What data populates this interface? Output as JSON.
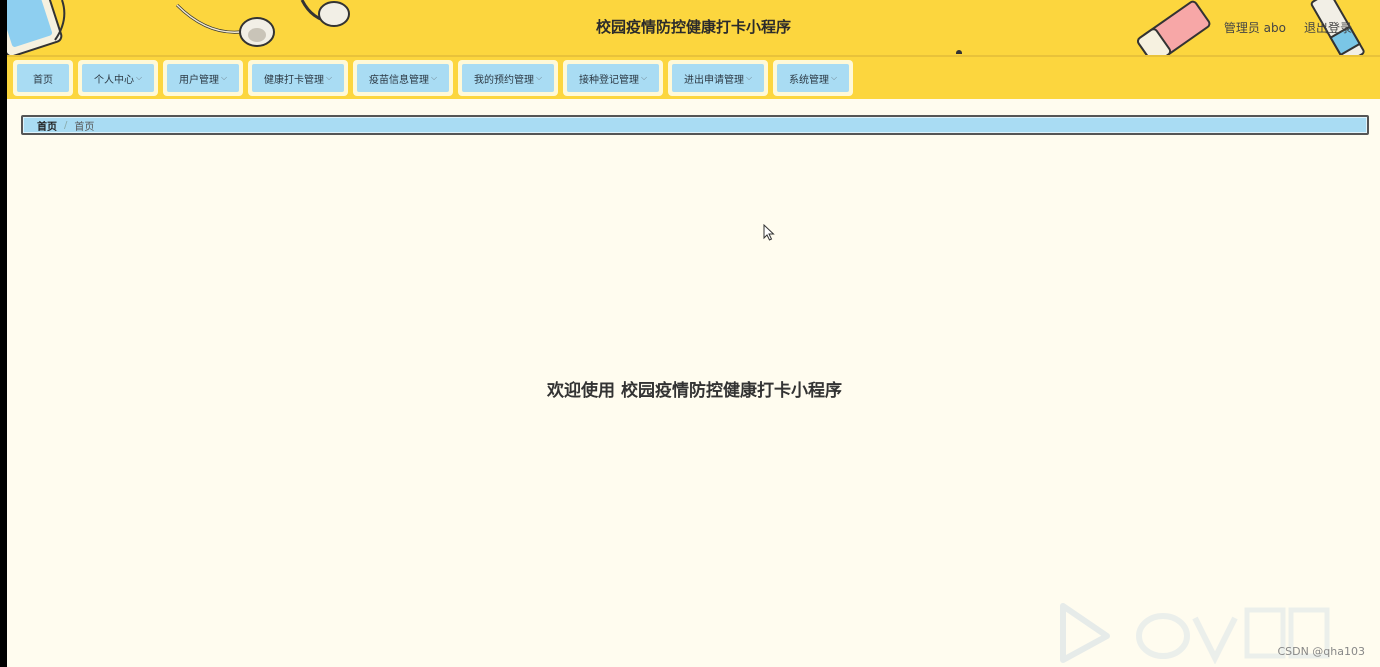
{
  "header": {
    "title": "校园疫情防控健康打卡小程序",
    "user_label": "管理员 abo",
    "logout_label": "退出登录"
  },
  "nav": {
    "items": [
      {
        "label": "首页",
        "has_dropdown": false
      },
      {
        "label": "个人中心",
        "has_dropdown": true
      },
      {
        "label": "用户管理",
        "has_dropdown": true
      },
      {
        "label": "健康打卡管理",
        "has_dropdown": true
      },
      {
        "label": "疫苗信息管理",
        "has_dropdown": true
      },
      {
        "label": "我的预约管理",
        "has_dropdown": true
      },
      {
        "label": "接种登记管理",
        "has_dropdown": true
      },
      {
        "label": "进出申请管理",
        "has_dropdown": true
      },
      {
        "label": "系统管理",
        "has_dropdown": true
      }
    ]
  },
  "breadcrumb": {
    "items": [
      "首页",
      "首页"
    ],
    "separator": "/"
  },
  "main": {
    "welcome_text": "欢迎使用 校园疫情防控健康打卡小程序"
  },
  "watermark": {
    "text": "CSDN @qha103"
  },
  "colors": {
    "header_yellow": "#fcd63e",
    "nav_blue": "#a9dcf3",
    "page_bg": "#fffcef"
  }
}
